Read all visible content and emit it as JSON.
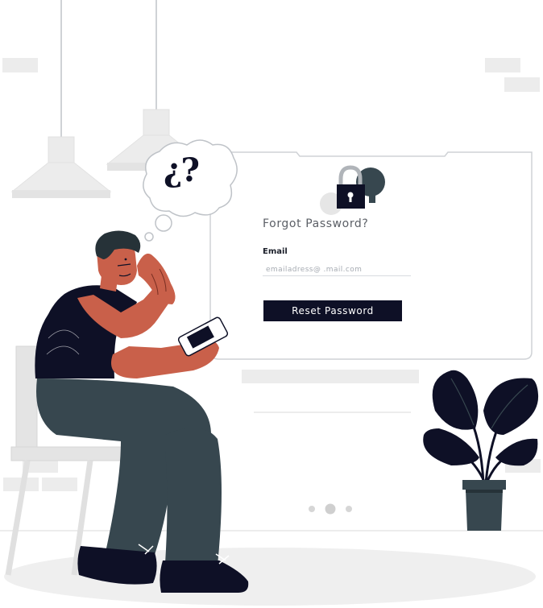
{
  "form": {
    "title": "Forgot Password?",
    "email_label": "Email",
    "email_placeholder": "emailadress@ .mail.com",
    "submit_label": "Reset Password"
  },
  "thought_bubble": {
    "text": "¿?"
  },
  "carousel": {
    "dots": 3,
    "active_index": 1
  },
  "colors": {
    "navy": "#0e1026",
    "skin": "#c9604a",
    "pants": "#37474f",
    "light_gray": "#ececec",
    "line_gray": "#bfc3c8"
  },
  "icons": [
    "padlock-icon",
    "question-mark-icon",
    "plant-icon",
    "lamp-icon"
  ]
}
